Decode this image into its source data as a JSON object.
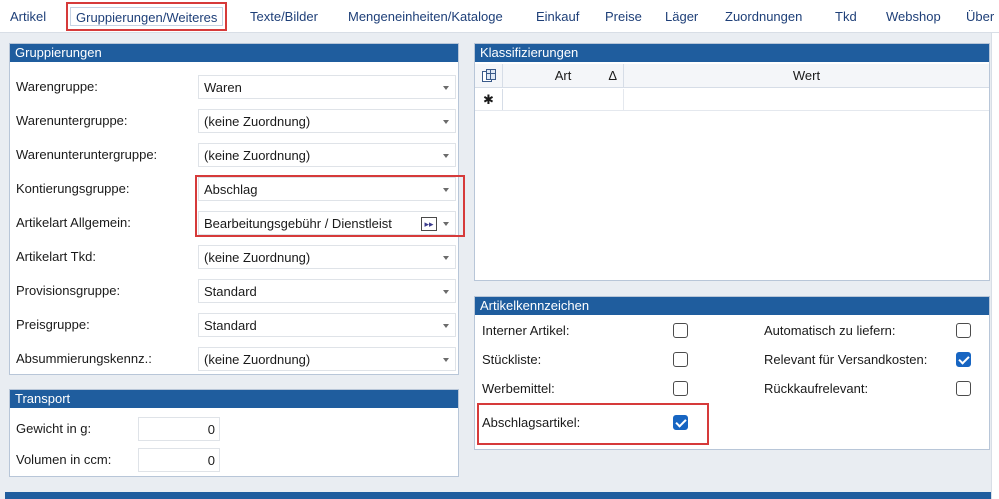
{
  "tabs": [
    {
      "label": "Artikel",
      "active": false
    },
    {
      "label": "Gruppierungen/Weiteres",
      "active": true
    },
    {
      "label": "Texte/Bilder",
      "active": false
    },
    {
      "label": "Mengeneinheiten/Kataloge",
      "active": false
    },
    {
      "label": "Einkauf",
      "active": false
    },
    {
      "label": "Preise",
      "active": false
    },
    {
      "label": "Läger",
      "active": false
    },
    {
      "label": "Zuordnungen",
      "active": false
    },
    {
      "label": "Tkd",
      "active": false
    },
    {
      "label": "Webshop",
      "active": false
    },
    {
      "label": "Über",
      "active": false
    }
  ],
  "gruppierungen": {
    "title": "Gruppierungen",
    "rows": [
      {
        "label": "Warengruppe:",
        "value": "Waren"
      },
      {
        "label": "Warenuntergruppe:",
        "value": "(keine Zuordnung)"
      },
      {
        "label": "Warenunteruntergruppe:",
        "value": "(keine Zuordnung)"
      },
      {
        "label": "Kontierungsgruppe:",
        "value": "Abschlag"
      },
      {
        "label": "Artikelart Allgemein:",
        "value": "Bearbeitungsgebühr / Dienstleist"
      },
      {
        "label": "Artikelart Tkd:",
        "value": "(keine Zuordnung)"
      },
      {
        "label": "Provisionsgruppe:",
        "value": "Standard"
      },
      {
        "label": "Preisgruppe:",
        "value": "Standard"
      },
      {
        "label": "Absummierungskennz.:",
        "value": "(keine Zuordnung)"
      }
    ],
    "jump_glyph": "▸▸"
  },
  "transport": {
    "title": "Transport",
    "rows": [
      {
        "label": "Gewicht in g:",
        "value": "0"
      },
      {
        "label": "Volumen in ccm:",
        "value": "0"
      }
    ]
  },
  "klassifizierungen": {
    "title": "Klassifizierungen",
    "columns": [
      "Art",
      "Wert"
    ],
    "sort_glyph": "Δ",
    "new_row_glyph": "✱"
  },
  "artikelkennzeichen": {
    "title": "Artikelkennzeichen",
    "left": [
      {
        "label": "Interner Artikel:",
        "checked": false
      },
      {
        "label": "Stückliste:",
        "checked": false
      },
      {
        "label": "Werbemittel:",
        "checked": false
      },
      {
        "label": "Abschlagsartikel:",
        "checked": true
      }
    ],
    "right": [
      {
        "label": "Automatisch zu liefern:",
        "checked": false
      },
      {
        "label": "Relevant für Versandkosten:",
        "checked": true
      },
      {
        "label": "Rückkaufrelevant:",
        "checked": false
      }
    ]
  },
  "colors": {
    "accent": "#1f5d9e",
    "highlight": "#d63a3a",
    "check": "#1765c2"
  }
}
